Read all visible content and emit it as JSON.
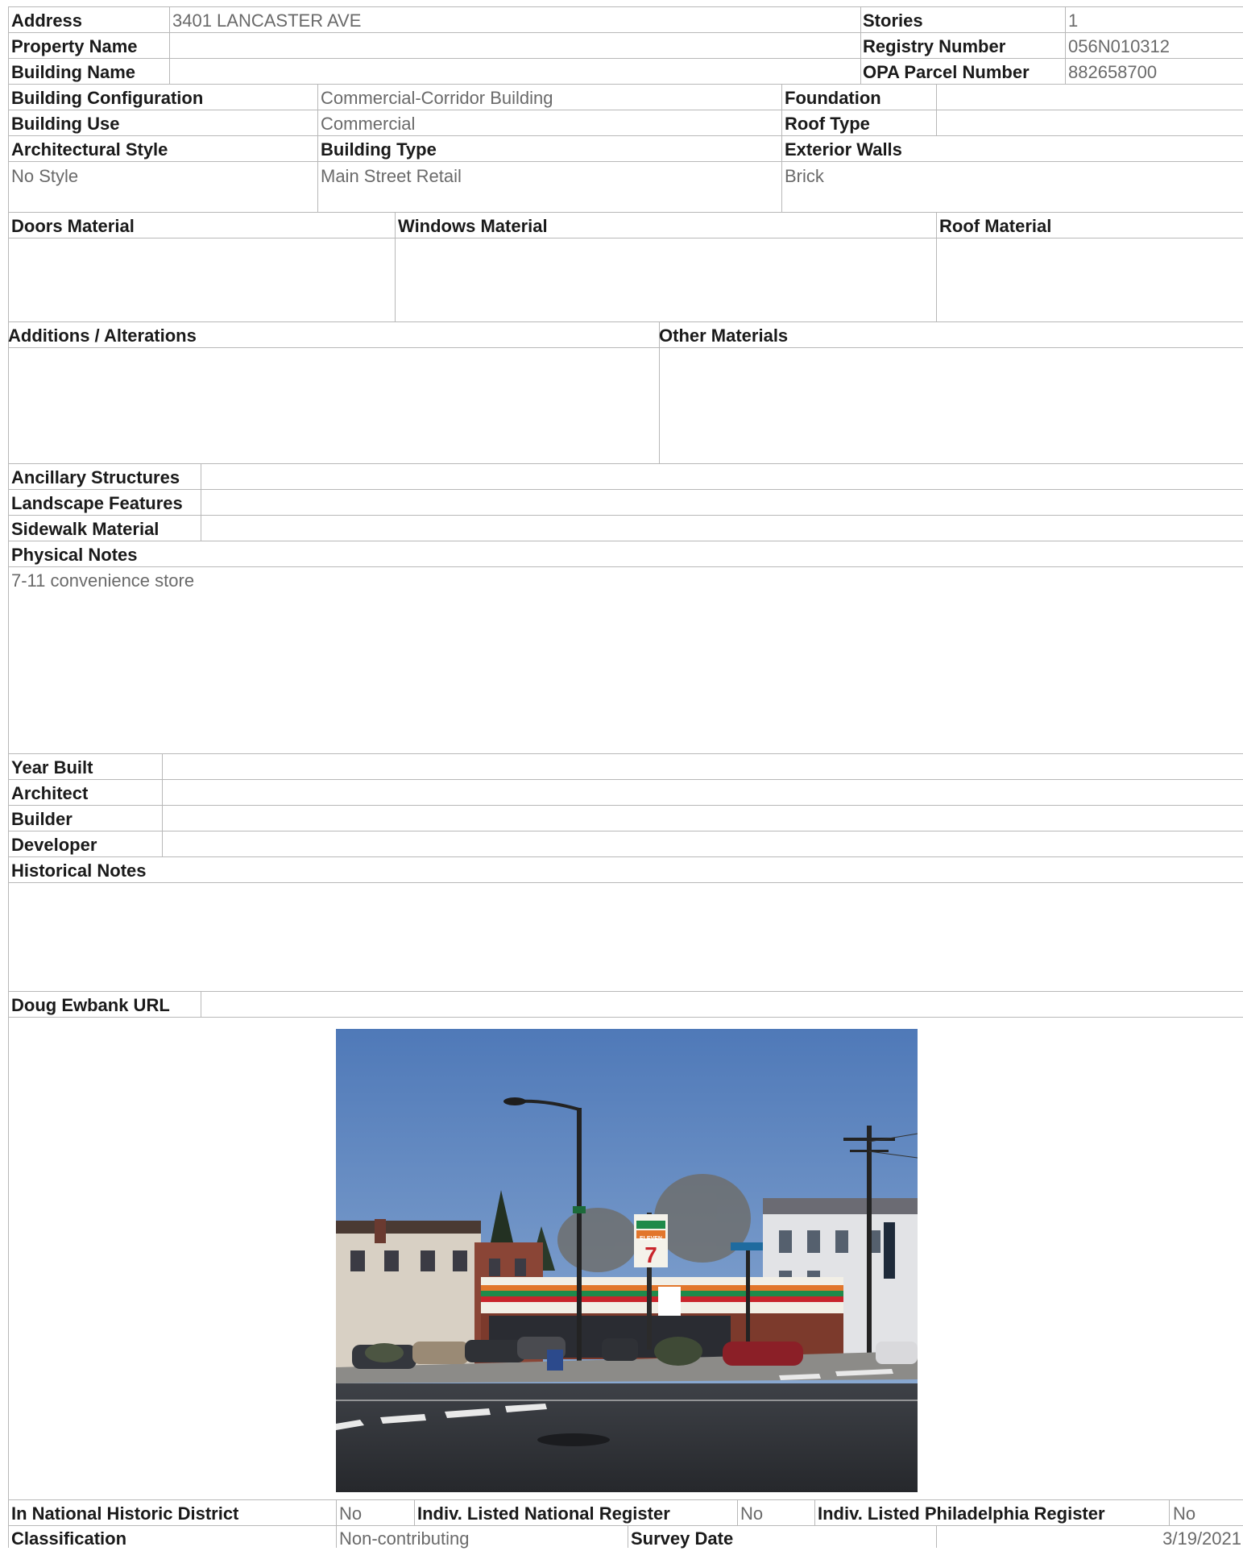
{
  "header": {
    "address_label": "Address",
    "address_value": "3401 LANCASTER AVE",
    "property_name_label": "Property Name",
    "property_name_value": "",
    "building_name_label": "Building Name",
    "building_name_value": "",
    "stories_label": "Stories",
    "stories_value": "1",
    "registry_number_label": "Registry Number",
    "registry_number_value": "056N010312",
    "opa_label": "OPA Parcel Number",
    "opa_value": "882658700"
  },
  "building": {
    "configuration_label": "Building Configuration",
    "configuration_value": "Commercial-Corridor Building",
    "use_label": "Building Use",
    "use_value": "Commercial",
    "foundation_label": "Foundation",
    "foundation_value": "",
    "roof_type_label": "Roof Type",
    "roof_type_value": "",
    "arch_style_label": "Architectural Style",
    "arch_style_value": "No Style",
    "building_type_label": "Building Type",
    "building_type_value": "Main Street Retail",
    "exterior_walls_label": "Exterior Walls",
    "exterior_walls_value": "Brick"
  },
  "materials": {
    "doors_label": "Doors Material",
    "windows_label": "Windows Material",
    "roof_label": "Roof Material",
    "additions_label": "Additions / Alterations",
    "other_label": "Other Materials"
  },
  "site": {
    "ancillary_label": "Ancillary Structures",
    "landscape_label": "Landscape Features",
    "sidewalk_label": "Sidewalk Material",
    "physical_notes_label": "Physical Notes",
    "physical_notes_value": "7-11 convenience store"
  },
  "history": {
    "year_built_label": "Year Built",
    "architect_label": "Architect",
    "builder_label": "Builder",
    "developer_label": "Developer",
    "historical_notes_label": "Historical Notes",
    "doug_ewbank_label": "Doug Ewbank URL"
  },
  "photo": {
    "sign_text": "ELEVEN",
    "sign_number": "7"
  },
  "footer": {
    "national_district_label": "In National Historic District",
    "national_district_value": "No",
    "national_register_label": "Indiv. Listed National Register",
    "national_register_value": "No",
    "phila_register_label": "Indiv. Listed Philadelphia Register",
    "phila_register_value": "No",
    "classification_label": "Classification",
    "classification_value": "Non-contributing",
    "survey_date_label": "Survey Date",
    "survey_date_value": "3/19/2021"
  }
}
